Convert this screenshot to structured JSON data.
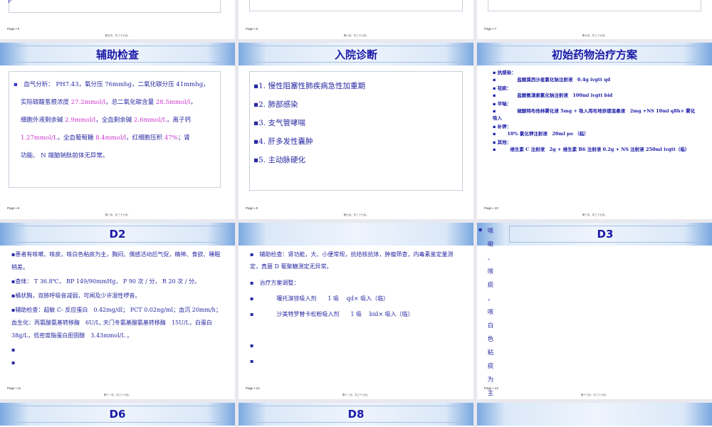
{
  "slides": {
    "top1": {
      "fragment": "P",
      "page": "Page ▪ 5",
      "footer": "第五页，共三十七页。"
    },
    "top2": {
      "page": "Page ▪ 6",
      "footer": "第六页，共三十七页。"
    },
    "top3": {
      "page": "Page ▪ 7",
      "footer": "第七页，共三十七页。"
    },
    "s5": {
      "title": "辅助检查",
      "bullet": "▪",
      "p1a": "血气分析： PH7.43，氧分压 76mmhg，二氧化碳分压 41mmhg，",
      "p2a": "实际碳酸氢根浓度 ",
      "p2b": "27.2mmol/l",
      "p2c": "，总二氧化碳含量 ",
      "p2d": "28.5mmol/l",
      "p2e": "，",
      "p3a": "细胞外液剩余碱 ",
      "p3b": "2.9mmol/l",
      "p3c": "，全血剩余碱 ",
      "p3d": "2.6mmol/L",
      "p3e": "，离子钙",
      "p4a": "1.27mmol/L",
      "p4b": "，全血葡萄糖 ",
      "p4c": "8.4mmol/l",
      "p4d": "，红细胞压积 ",
      "p4e": "47%",
      "p4f": "；肾",
      "p5": "功能、 N 端脑钠肽前体无异常。",
      "page": "Page ▪ 8",
      "footer": "第八页，共三十七页。"
    },
    "s6": {
      "title": "入院诊断",
      "items": [
        "▪1. 慢性阻塞性肺疾病急性加重期",
        "▪2. 肺部感染",
        "▪3. 支气管哮喘",
        "▪4. 肝多发性囊肿",
        "▪5. 主动脉硬化"
      ],
      "page": "Page ▪ 9",
      "footer": "第九页，共三十七页。"
    },
    "s7": {
      "title": "初始药物治疗方案",
      "l1": "▪ 抗感染：",
      "l2": "盐酸莫西沙星氯化钠注射液　0.4g  ivgtt qd",
      "l3": "▪ 祛痰：",
      "l4": "盐酸氨溴索氯化钠注射液　100ml  ivgtt  bid",
      "l5": "▪ 平喘：",
      "l6": "硫酸特布他林雾化液 5mg + 吸入用布地奈德混悬液　2mg +NS 10ml  q8h× 雾化吸入",
      "l7": "▪ 补钾：",
      "l8": "10% 氯化钾注射液　20ml  po  （临）",
      "l9": "▪ 其他：",
      "l10": "维生素 C 注射液　2g + 维生素 B6 注射液 0.2g + NS 注射液 250ml  ivgtt（临）",
      "marker": "▪",
      "page": "Page ▪ 10",
      "footer": "第十页，共三十七页。"
    },
    "s8": {
      "title": "D2",
      "p1": "▪患者有咳嗽、咳痰，咳白色粘痰为主，胸闷、偶感活动后气促，精神、食欲、睡眠稍差。",
      "p2": "▪查体： T 36.8℃， BP 149/90mmHg， P 90 次 / 分， R 20 次 / 分。",
      "p3": "▪桶状胸，双肺呼吸音减弱，可闻及少许湿性啰音。",
      "p4": "▪辅助检查：超敏 C- 反应蛋白　0.42mg/dl； PCT 0.02ng/ml；血沉 20mm/h；血生化：丙氨酸氨基转移酶　6U/L, 天门冬氨基酸氨基转移酶　15U/L，白蛋白 38g/L，低密度脂蛋白胆固醇　3.43mmol/L 。",
      "p5": "▪",
      "p6": "▪",
      "page": "Page ▪ 11",
      "footer": "第十一页，共三十七页。"
    },
    "s9": {
      "p1": "▪　辅助检查：肾功能，大、小便常规，抗结核抗体，肿瘤筛查，内毒素鉴定量测定，真菌 D 葡聚糖测定无异常。",
      "p2": "▪　治疗方案调整：",
      "p3": "▪　　　　噻托溴铵吸入剂　　1 吸　 qd× 吸入（临）",
      "p4": "▪　　　　沙美特罗替卡松粉吸入剂　　1 吸　 bid× 吸入（临）",
      "p5": "▪",
      "p6": "▪",
      "page": "Page ▪ 12",
      "footer": "第十二页，共三十七页。"
    },
    "s10": {
      "title": "D3",
      "bullet": "▪",
      "vtext": [
        "咳",
        "嗽",
        "、",
        "咳",
        "痰",
        "，",
        "咳",
        "白",
        "色",
        "粘",
        "痰",
        "为",
        "主",
        "，"
      ],
      "page": "Page ▪ 13",
      "footer": "第十三页，共三十七页。"
    },
    "s11": {
      "title": "D6"
    },
    "s12": {
      "title": "D8"
    }
  }
}
